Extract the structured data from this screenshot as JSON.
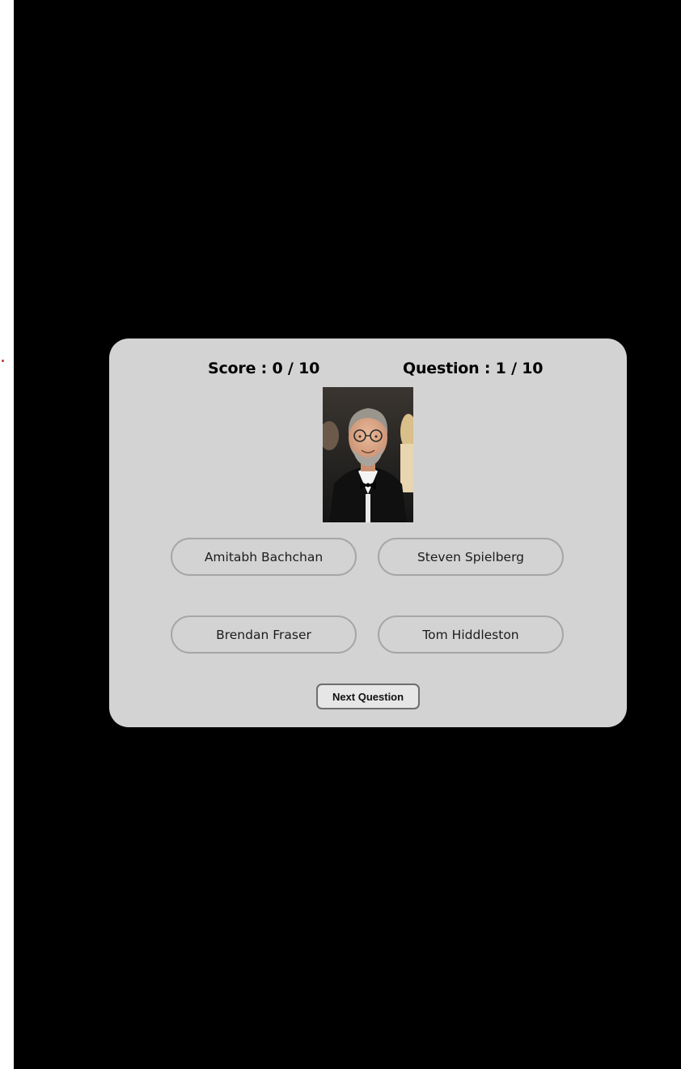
{
  "quiz": {
    "score_text": "Score : 0 / 10",
    "question_text": "Question : 1 / 10",
    "photo_icon": "person-portrait-icon",
    "options": [
      {
        "label": "Amitabh Bachchan"
      },
      {
        "label": "Steven Spielberg"
      },
      {
        "label": "Brendan Fraser"
      },
      {
        "label": "Tom Hiddleston"
      }
    ],
    "next_label": "Next Question"
  },
  "colors": {
    "background": "#000000",
    "card": "#d3d3d3",
    "option_border": "#a6a6a6",
    "next_border": "#6e6e6e"
  }
}
